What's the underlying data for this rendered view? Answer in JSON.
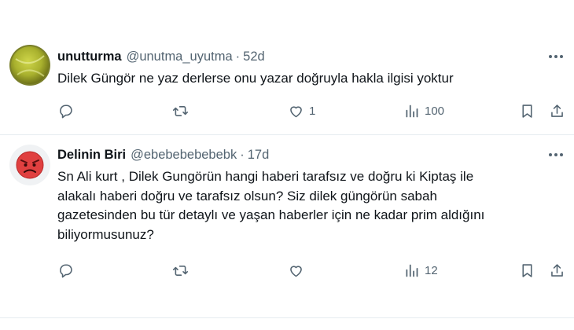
{
  "tweets": [
    {
      "display_name": "unutturma",
      "handle": "@unutma_uyutma",
      "separator": "·",
      "time": "52d",
      "text": "Dilek Güngör ne yaz derlerse onu yazar doğruyla hakla ilgisi yoktur",
      "like_count": "1",
      "view_count": "100"
    },
    {
      "display_name": "Delinin Biri",
      "handle": "@ebebebebebebk",
      "separator": "·",
      "time": "17d",
      "text_lines": [
        "Sn Ali kurt , Dilek Gungörün hangi haberi tarafsız ve doğru ki Kiptaş ile",
        "alakalı haberi doğru ve tarafsız olsun? Siz dilek güngörün sabah",
        "gazetesinden bu tür detaylı ve yaşan haberler için ne kadar prim aldığını",
        "biliyormusunuz?"
      ],
      "like_count": "",
      "view_count": "12"
    }
  ],
  "icons": {
    "reply": "reply-icon",
    "retweet": "retweet-icon",
    "like": "heart-icon",
    "views": "views-icon",
    "bookmark": "bookmark-icon",
    "share": "share-icon",
    "more": "more-icon"
  },
  "colors": {
    "text": "#0f1419",
    "secondary": "#536471",
    "divider": "#e6ecf0"
  }
}
